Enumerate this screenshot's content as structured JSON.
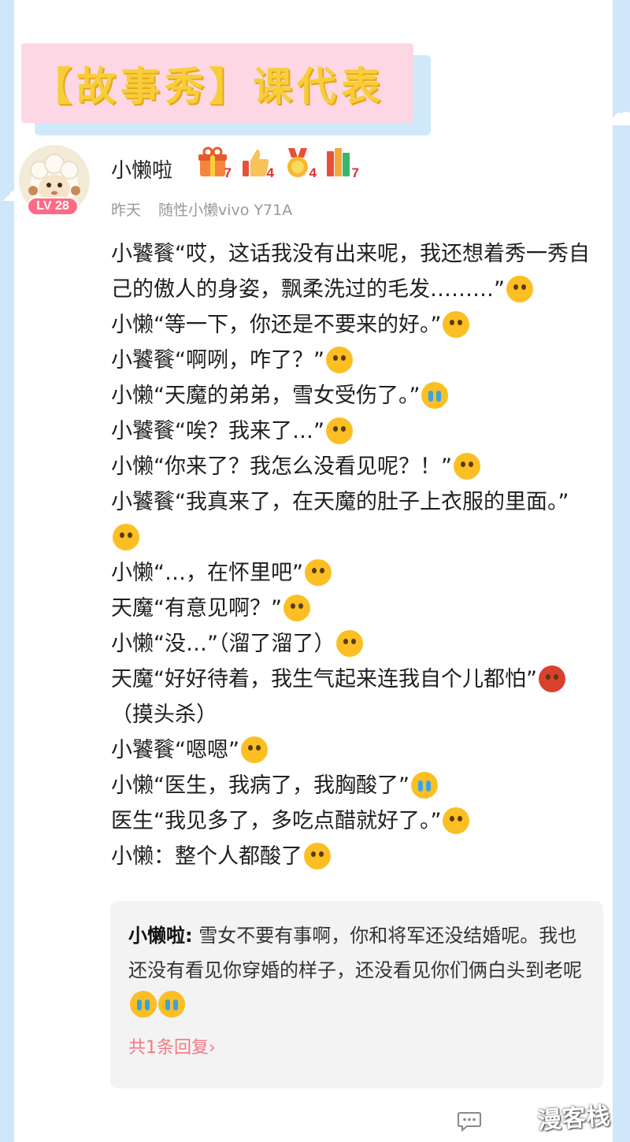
{
  "banner": {
    "title": "【故事秀】课代表"
  },
  "post": {
    "username": "小懒啦",
    "level": "LV 28",
    "badges": [
      {
        "icon": "gift-badge-icon",
        "count": "7"
      },
      {
        "icon": "thumbs-up-badge-icon",
        "count": "4"
      },
      {
        "icon": "medal-badge-icon",
        "count": "4"
      },
      {
        "icon": "books-badge-icon",
        "count": "7"
      }
    ],
    "time": "昨天",
    "device": "随性小懒vivo Y71A",
    "lines": [
      "小饕餮“哎，这话我没有出来呢，我还想着秀一秀自己的傲人的身姿，飘柔洗过的毛发………”",
      "小懒“等一下，你还是不要来的好。”",
      "小饕餮“啊咧，咋了？”",
      "小懒“天魔的弟弟，雪女受伤了。”",
      "小饕餮“唉？我来了…”",
      "小懒“你来了？我怎么没看见呢？！”",
      "小饕餮“我真来了，在天魔的肚子上衣服的里面。”",
      "小懒“…，在怀里吧”",
      "天魔“有意见啊？”",
      "小懒“没…”（溜了溜了）",
      "天魔“好好待着，我生气起来连我自个儿都怕”",
      "（摸头杀）",
      "小饕餮“嗯嗯”",
      "小懒“医生，我病了，我胸酸了”",
      "医生“我见多了，多吃点醋就好了。”",
      "小懒：整个人都酸了"
    ]
  },
  "comment": {
    "author": "小懒啦:",
    "text": "雪女不要有事啊，你和将军还没结婚呢。我也还没有看见你穿婚的样子，还没看见你们俩白头到老呢",
    "reply_link": "共1条回复",
    "reply_arrow": "›"
  },
  "watermark": "漫客栈",
  "colors": {
    "banner_bg": "#fdd8e4",
    "banner_text": "#f7cd3a",
    "level_badge": "#ff6a84",
    "reply_link": "#f27a86",
    "page_bg": "#cfe6fb"
  }
}
